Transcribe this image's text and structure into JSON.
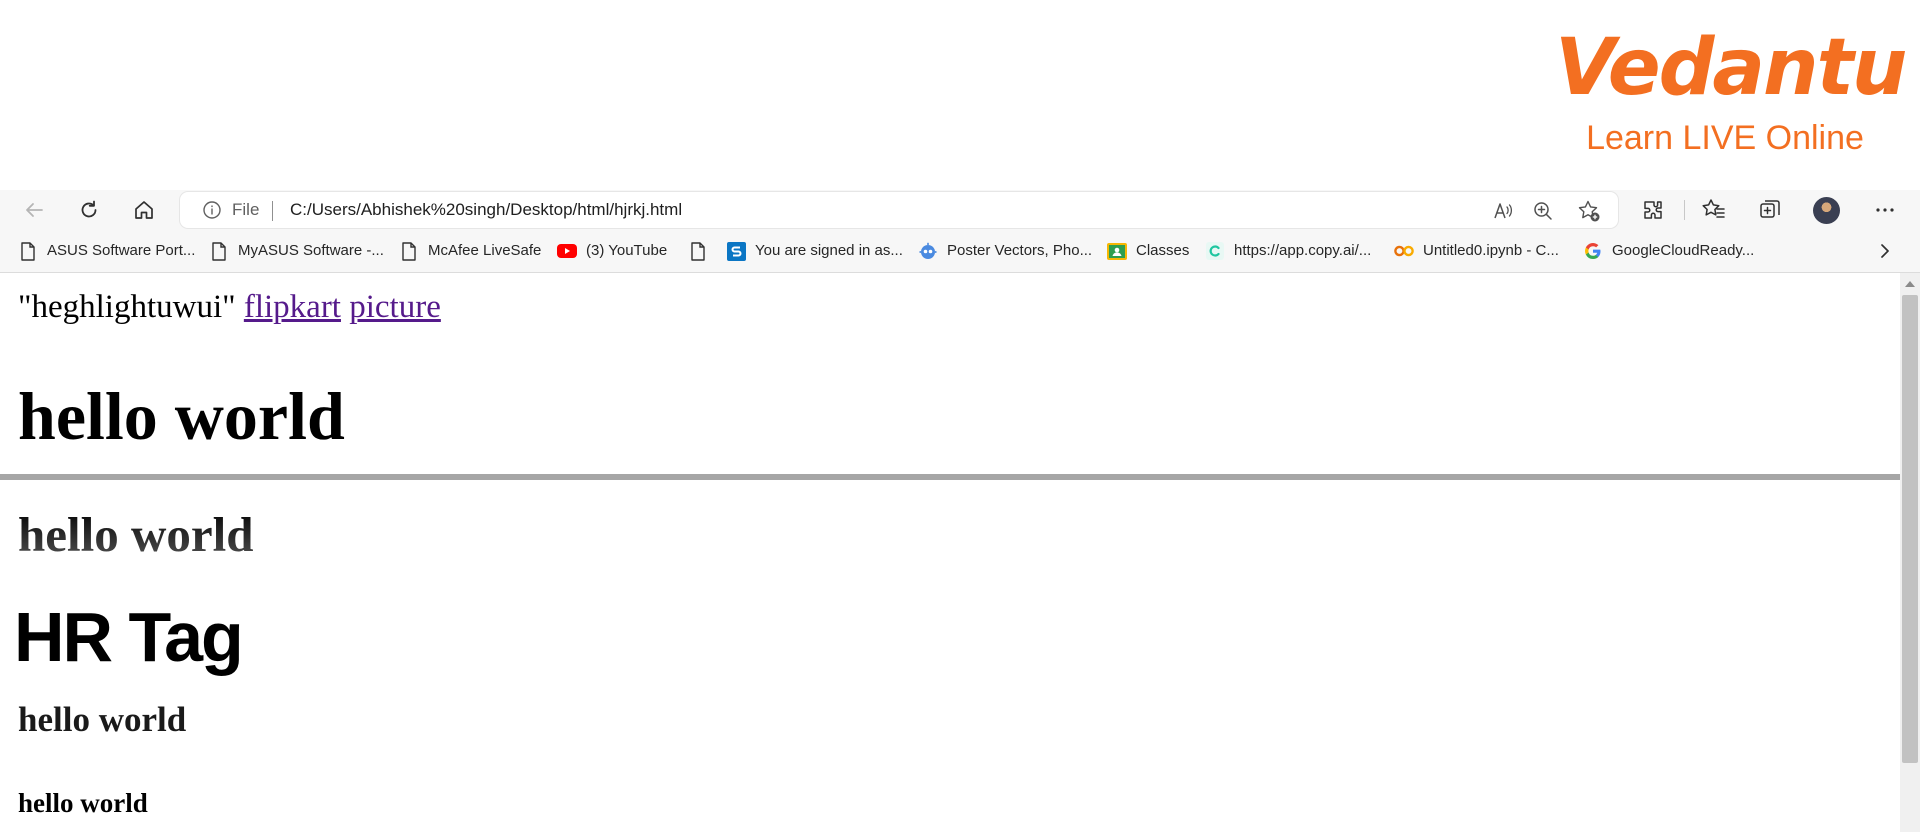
{
  "brand": {
    "name": "Vedantu",
    "tagline": "Learn LIVE Online",
    "color": "#f36f21"
  },
  "toolbar": {
    "icons": [
      "back-icon",
      "refresh-icon",
      "home-icon"
    ],
    "address": {
      "scheme_label": "File",
      "url": "C:/Users/Abhishek%20singh/Desktop/html/hjrkj.html"
    },
    "address_icons": [
      "read-aloud-icon",
      "zoom-icon",
      "add-favorite-icon"
    ],
    "right_icons": [
      "extensions-icon",
      "favorites-icon",
      "collections-icon",
      "avatar",
      "more-icon"
    ]
  },
  "bookmarks": [
    {
      "label": "ASUS Software Port...",
      "icon": "page-icon"
    },
    {
      "label": "MyASUS Software -...",
      "icon": "page-icon"
    },
    {
      "label": "McAfee LiveSafe",
      "icon": "page-icon"
    },
    {
      "label": "(3) YouTube",
      "icon": "youtube-icon"
    },
    {
      "label": "",
      "icon": "page-icon"
    },
    {
      "label": "You are signed in as...",
      "icon": "s-logo-icon"
    },
    {
      "label": "Poster Vectors, Pho...",
      "icon": "bot-icon"
    },
    {
      "label": "Classes",
      "icon": "classroom-icon"
    },
    {
      "label": "https://app.copy.ai/...",
      "icon": "copyai-icon"
    },
    {
      "label": "Untitled0.ipynb - C...",
      "icon": "colab-icon"
    },
    {
      "label": "GoogleCloudReady...",
      "icon": "google-icon"
    }
  ],
  "page": {
    "intro_text": "\"heghlightuwui\"",
    "link1": "flipkart",
    "link2": "picture",
    "heading1": "hello world",
    "heading2": "hello world",
    "hr_tag": "HR Tag",
    "heading3": "hello world",
    "heading4": "hello world"
  },
  "colors": {
    "link_visited": "#551a8b",
    "hr": "#a6a6a6",
    "chrome_bg": "#f7f7f7"
  }
}
